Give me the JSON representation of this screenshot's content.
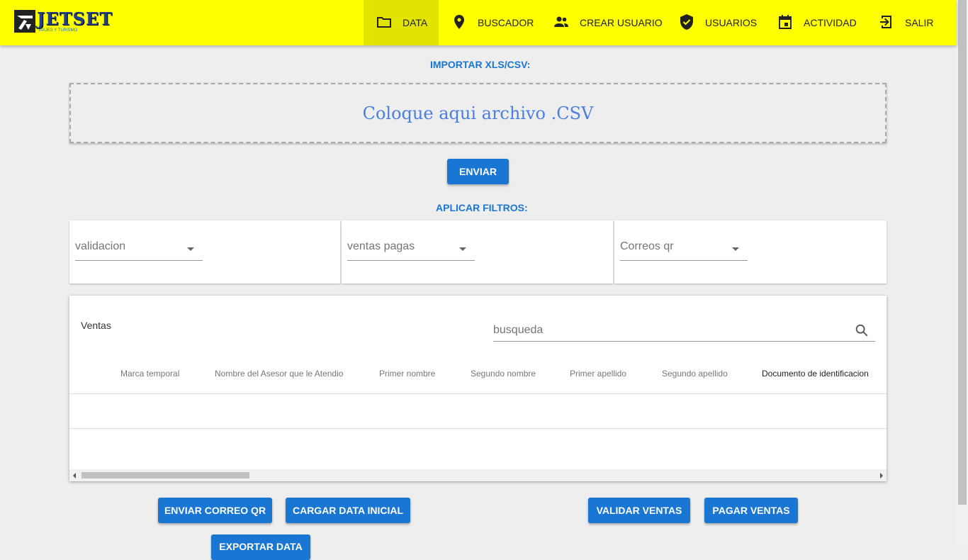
{
  "app": {
    "logo_text": "JETSET",
    "logo_tagline": "VIAJES Y TURISMO"
  },
  "nav": [
    {
      "label": "DATA",
      "icon": "folder-icon",
      "active": true
    },
    {
      "label": "BUSCADOR",
      "icon": "location-pin-icon"
    },
    {
      "label": "CREAR USUARIO",
      "icon": "people-icon"
    },
    {
      "label": "USUARIOS",
      "icon": "shield-check-icon"
    },
    {
      "label": "ACTIVIDAD",
      "icon": "calendar-icon"
    },
    {
      "label": "SALIR",
      "icon": "exit-icon"
    }
  ],
  "import": {
    "title": "IMPORTAR XLS/CSV:",
    "dropzone_text": "Coloque aqui archivo .CSV",
    "send_button": "ENVIAR"
  },
  "filters": {
    "title": "APLICAR FILTROS:",
    "selects": [
      {
        "placeholder": "validacion"
      },
      {
        "placeholder": "ventas pagas"
      },
      {
        "placeholder": "Correos qr"
      }
    ]
  },
  "table": {
    "title": "Ventas",
    "search_placeholder": "busqueda",
    "columns": [
      "Marca temporal",
      "Nombre del Asesor que le Atendio",
      "Primer nombre",
      "Segundo nombre",
      "Primer apellido",
      "Segundo apellido",
      "Documento de identificacion"
    ]
  },
  "actions": {
    "send_qr": "ENVIAR CORREO QR",
    "load_initial": "CARGAR DATA INICIAL",
    "validate_sales": "VALIDAR VENTAS",
    "pay_sales": "PAGAR VENTAS",
    "export": "EXPORTAR DATA"
  },
  "colors": {
    "topbar": "#ffff00",
    "primary": "#1976d2",
    "dropzone_text": "#4a7fe0"
  }
}
